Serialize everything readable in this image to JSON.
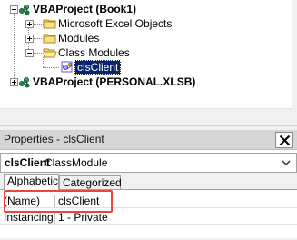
{
  "project_tree": {
    "items": [
      {
        "label": "VBAProject (Book1)",
        "icon": "vba-project-icon",
        "expanded": true
      },
      {
        "label": "Microsoft Excel Objects",
        "icon": "folder-icon",
        "expanded": false
      },
      {
        "label": "Modules",
        "icon": "folder-icon",
        "expanded": false
      },
      {
        "label": "Class Modules",
        "icon": "folder-open-icon",
        "expanded": true
      },
      {
        "label": "clsClient",
        "icon": "class-module-icon",
        "selected": true
      },
      {
        "label": "VBAProject (PERSONAL.XLSB)",
        "icon": "vba-project-icon",
        "expanded": false
      }
    ]
  },
  "properties": {
    "title": "Properties - clsClient",
    "object_name": "clsClient",
    "object_type": "ClassModule",
    "tabs": [
      {
        "label": "Alphabetic",
        "active": true
      },
      {
        "label": "Categorized",
        "active": false
      }
    ],
    "rows": [
      {
        "name": "(Name)",
        "value": "clsClient"
      },
      {
        "name": "Instancing",
        "value": "1 - Private"
      }
    ]
  },
  "colors": {
    "selection_bg": "#0a246a",
    "highlight_box": "#e8473f",
    "title_bar": "#d6d6d6"
  }
}
